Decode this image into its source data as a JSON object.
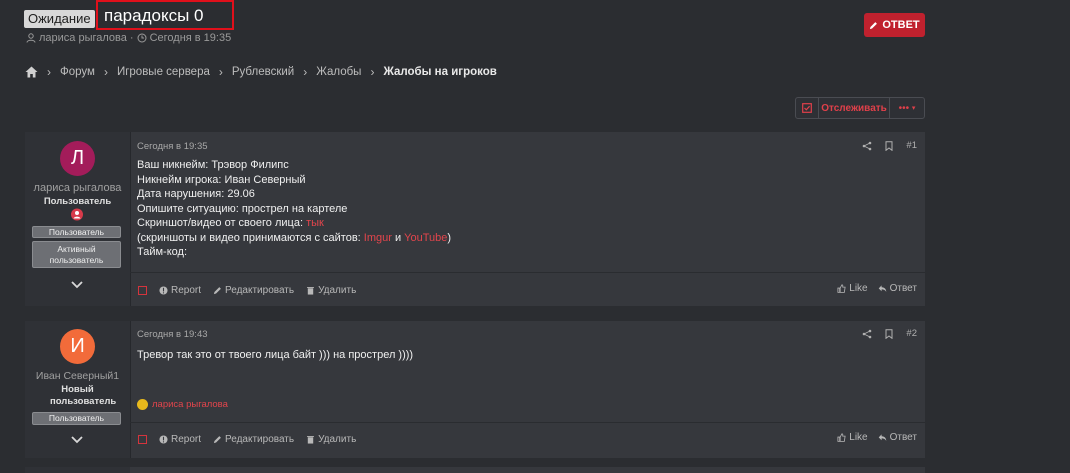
{
  "thread": {
    "prefix": "Ожидание",
    "title": "парадоксы 0",
    "author": "лариса рыгалова",
    "date": "Сегодня в 19:35",
    "sep": "·"
  },
  "reply_button": "ОТВЕТ",
  "breadcrumbs": [
    "Форум",
    "Игровые сервера",
    "Рублевский",
    "Жалобы",
    "Жалобы на игроков"
  ],
  "watch": {
    "label": "Отслеживать",
    "more": "•••"
  },
  "colors": {
    "accent": "#c0212e",
    "link_red": "#e2454c",
    "avatar1": "#a31c5a",
    "avatar2": "#f26b3a"
  },
  "posts": [
    {
      "avatar_letter": "Л",
      "username": "лариса рыгалова",
      "user_title": "Пользователь",
      "badges": [
        "Пользователь",
        "Активный пользователь"
      ],
      "date": "Сегодня в 19:35",
      "number": "#1",
      "lines": [
        "Ваш никнейм: Трэвор Филипс",
        "Никнейм игрока: Иван Северный",
        "Дата нарушения: 29.06",
        "Опишите ситуацию: прострел на картеле"
      ],
      "video_label": "Скриншот/видео от своего лица: ",
      "video_link": "тык",
      "hosts_prefix": "(скриншоты и видео принимаются с сайтов: ",
      "host1": "Imgur",
      "hosts_and": " и ",
      "host2": "YouTube",
      "hosts_suffix": ")",
      "timecode": "Тайм-код:"
    },
    {
      "avatar_letter": "И",
      "username": "Иван Северный1",
      "user_title": "Новый пользователь",
      "badges": [
        "Пользователь"
      ],
      "date": "Сегодня в 19:43",
      "number": "#2",
      "text": "Тревор так это от твоего лица байт ))) на прострел ))))",
      "liked_by": "лариса рыгалова"
    }
  ],
  "actions": {
    "report": "Report",
    "edit": "Редактировать",
    "delete": "Удалить",
    "like": "Like",
    "reply": "Ответ"
  }
}
